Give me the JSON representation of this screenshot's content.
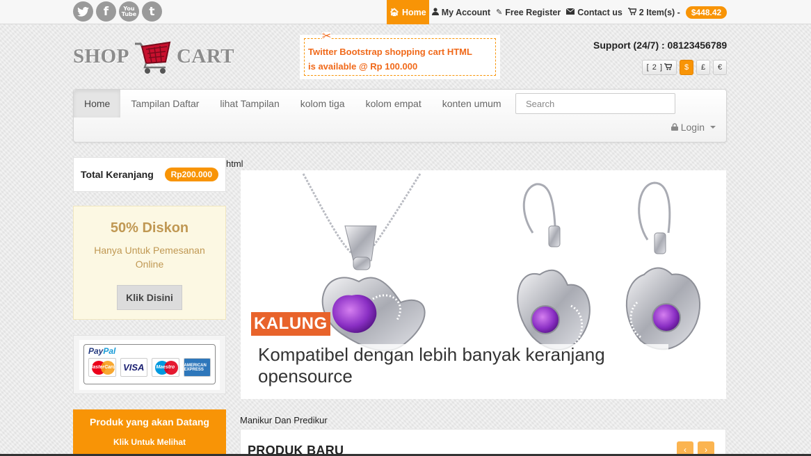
{
  "social": {
    "twitter": "t",
    "facebook": "f",
    "youtube_top": "You",
    "youtube_bottom": "Tube",
    "tumblr": "t"
  },
  "topnav": {
    "home": "Home",
    "account": "My Account",
    "register": "Free Register",
    "contact": "Contact us",
    "cart_items": "2 Item(s) -",
    "cart_total": "$448.42"
  },
  "header": {
    "logo_left": "SHOP",
    "logo_right": "CART",
    "promo_line1": "Twitter Bootstrap shopping cart HTML",
    "promo_line2": "is available @ Rp 100.000",
    "support": "Support (24/7) : 08123456789",
    "mini_cart": "[ 2 ]",
    "currencies": [
      "$",
      "£",
      "€"
    ]
  },
  "nav": {
    "links": [
      "Home",
      "Tampilan Daftar",
      "lihat Tampilan",
      "kolom tiga",
      "kolom empat",
      "konten umum"
    ],
    "search_placeholder": "Search",
    "login": "Login"
  },
  "sidebar": {
    "total_label": "Total Keranjang",
    "total_price": "Rp200.000",
    "discount_title": "50% Diskon",
    "discount_text": "Hanya Untuk Pemesanan Online",
    "discount_button": "Klik Disini",
    "paypal_pay": "Pay",
    "paypal_pal": "Pal",
    "card_mastercard": "MasterCard",
    "card_visa": "VISA",
    "card_maestro": "Maestro",
    "card_amex": "AMERICAN EXPRESS",
    "coming_title": "Produk yang akan Datang",
    "coming_link": "Klik Untuk Melihat"
  },
  "main": {
    "html_label": "html",
    "slide_tag": "KALUNG",
    "slide_caption": "Kompatibel dengan lebih banyak keranjang opensource",
    "section_label": "Manikur Dan Predikur",
    "produk_title": "PRODUK BARU",
    "prev_arrow": "‹",
    "next_arrow": "›"
  },
  "colors": {
    "accent": "#f89406",
    "promo_text": "#f0691a",
    "slide_tag": "#e8632b",
    "discount_text": "#c09853"
  }
}
